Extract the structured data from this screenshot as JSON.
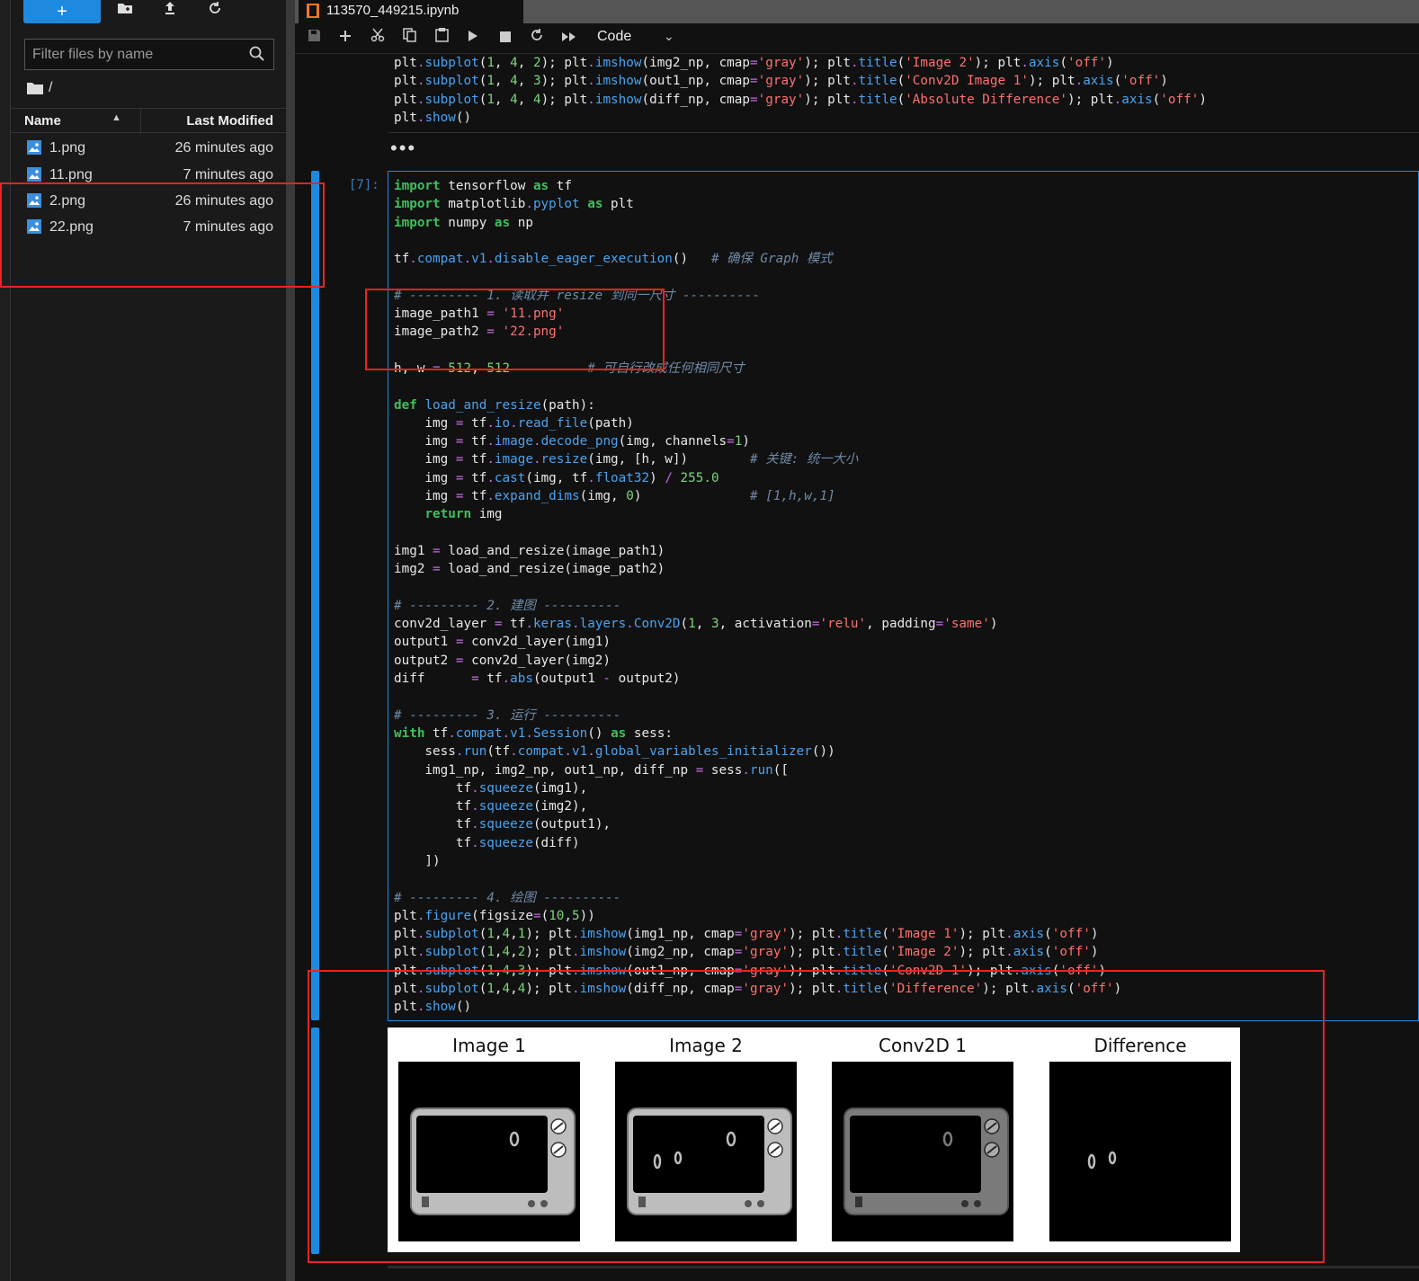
{
  "filebrowser": {
    "new_label": "+",
    "filter_placeholder": "Filter files by name",
    "breadcrumb": "/",
    "columns": {
      "name": "Name",
      "modified": "Last Modified"
    },
    "files": [
      {
        "name": "1.png",
        "modified": "26 minutes ago"
      },
      {
        "name": "11.png",
        "modified": "7 minutes ago"
      },
      {
        "name": "2.png",
        "modified": "26 minutes ago"
      },
      {
        "name": "22.png",
        "modified": "7 minutes ago"
      }
    ]
  },
  "notebook": {
    "tab_title": "113570_449215.ipynb",
    "cell_type": "Code",
    "prompt": "[7]:",
    "ellipsis": "•••",
    "figure_titles": [
      "Image 1",
      "Image 2",
      "Conv2D 1",
      "Difference"
    ]
  },
  "icons": {
    "toolbar": [
      "save-icon",
      "add-cell-icon",
      "cut-icon",
      "copy-icon",
      "paste-icon",
      "run-icon",
      "stop-icon",
      "restart-icon",
      "fast-forward-icon"
    ],
    "filebrowser_toolbar": [
      "new-folder-icon",
      "upload-icon",
      "refresh-icon"
    ]
  },
  "colors": {
    "accent": "#1d8ae0",
    "annotation_red": "#e22222"
  }
}
